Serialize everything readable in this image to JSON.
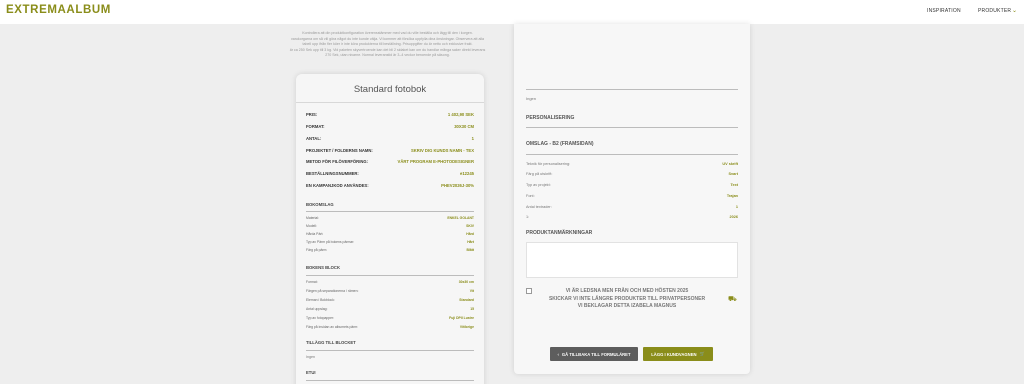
{
  "header": {
    "logo": "EXTREMAALBUM",
    "nav": [
      "INSPIRATION",
      "PRODUKTER"
    ]
  },
  "intro": {
    "lines": [
      "Kontrollera att din produktkonfiguration överensstämmer med vad du ville beställa och lägg till den i korgen.",
      "varukorgarna om så vill göra något du inte kunde välja. Vi kommer att försöka uppfylla dina önskningar. Observera att alla",
      "tabell upp ifrån fler köer ir inte köra produkterna till beställning. Prisuppgifter du är netto och exklusive frakt.",
      "är ca 250 Sek upp till 3 kg. Vid paketen skyvertroende kan det bli 2 sidaket kan om du handlar många saker direkt leverans",
      "270 Sek, utan nivarne. Normal leveranstid är 3–4 veckor beroende på säsong."
    ]
  },
  "order": {
    "title": "Standard fotobok",
    "main_rows": [
      {
        "k": "PRIS:",
        "v": "1 402,90 SEK"
      },
      {
        "k": "FORMAT:",
        "v": "30X30 CM"
      },
      {
        "k": "ANTAL:",
        "v": "1"
      },
      {
        "k": "PROJEKTET / FOLDERNS NAMN:",
        "v": "SKRIV DIG KUNDS NAMN - TEX"
      },
      {
        "k": "METOD FÖR FILÖVERFÖRING:",
        "v": "VÅRT PROGRAM E-PHOTODESIGNER"
      },
      {
        "k": "BESTÄLLNINGSNUMMER:",
        "v": "e12245"
      },
      {
        "k": "EN KAMPANJKOD ANVÄNDES:",
        "v": "PHEV2026J-30%"
      }
    ],
    "cover_title": "BOKOMSLAG",
    "cover_rows": [
      {
        "k": "Material:",
        "v": "ENKEL GOLANT"
      },
      {
        "k": "Modell:",
        "v": "SKIV"
      },
      {
        "k": "Hårda Pärt:",
        "v": "Hård"
      },
      {
        "k": "Typ av Pärm på bokens pärmar:",
        "v": "Hårt"
      },
      {
        "k": "Färg på pärm:",
        "v": "Blått"
      }
    ],
    "block_title": "BOKENS BLOCK",
    "block_rows": [
      {
        "k": "Format:",
        "v": "30x30 cm"
      },
      {
        "k": "Färgen på separationerna / rämen:",
        "v": "Vit"
      },
      {
        "k": "Eleman i Bokblock:",
        "v": "Standard"
      },
      {
        "k": "Antal uppslag:",
        "v": "15"
      },
      {
        "k": "Typ av fotopapper:",
        "v": "Fuji DPII Lustre"
      },
      {
        "k": "Färg på insidan av albumets pärm:",
        "v": "Vit/beige"
      }
    ],
    "addons_title": "TILLÄGG TILL BLOCKET",
    "addons_value": "Ingen",
    "etui_title": "ETUI"
  },
  "details": {
    "top_value": "Ingen",
    "personal_title": "PERSONALISERING",
    "cover_title": "OMSLAG - B2 (FRAMSIDAN)",
    "rows": [
      {
        "k": "Teknik för personalisering:",
        "v": "UV skrift"
      },
      {
        "k": "Färg på utskrift:",
        "v": "Svart"
      },
      {
        "k": "Typ av projekt:",
        "v": "Text"
      },
      {
        "k": "Font:",
        "v": "Trajan"
      },
      {
        "k": "Antal textrader:",
        "v": "1"
      },
      {
        "k": "1:",
        "v": "2026"
      }
    ],
    "notes_title": "PRODUKTANMÄRKNINGAR",
    "notice_lines": [
      "VI ÄR LEDSNA MEN FRÅN OCH MED HÖSTEN 2025",
      "SKICKAR VI INTE LÄNGRE PRODUKTER TILL PRIVATPERSONER",
      "VI BEKLAGAR DETTA IZABELA MAGNUS"
    ],
    "back_button": "GÅ TILLBAKA TILL FORMULÄRET",
    "cart_button": "LÄGG I KUNDVAGNEN"
  },
  "icons": {
    "chevron": "chevron-down-icon",
    "back": "chevron-left-icon",
    "cart": "cart-icon",
    "truck": "truck-icon"
  },
  "colors": {
    "accent": "#8a8d1a",
    "back_button": "#5d5d5d"
  }
}
